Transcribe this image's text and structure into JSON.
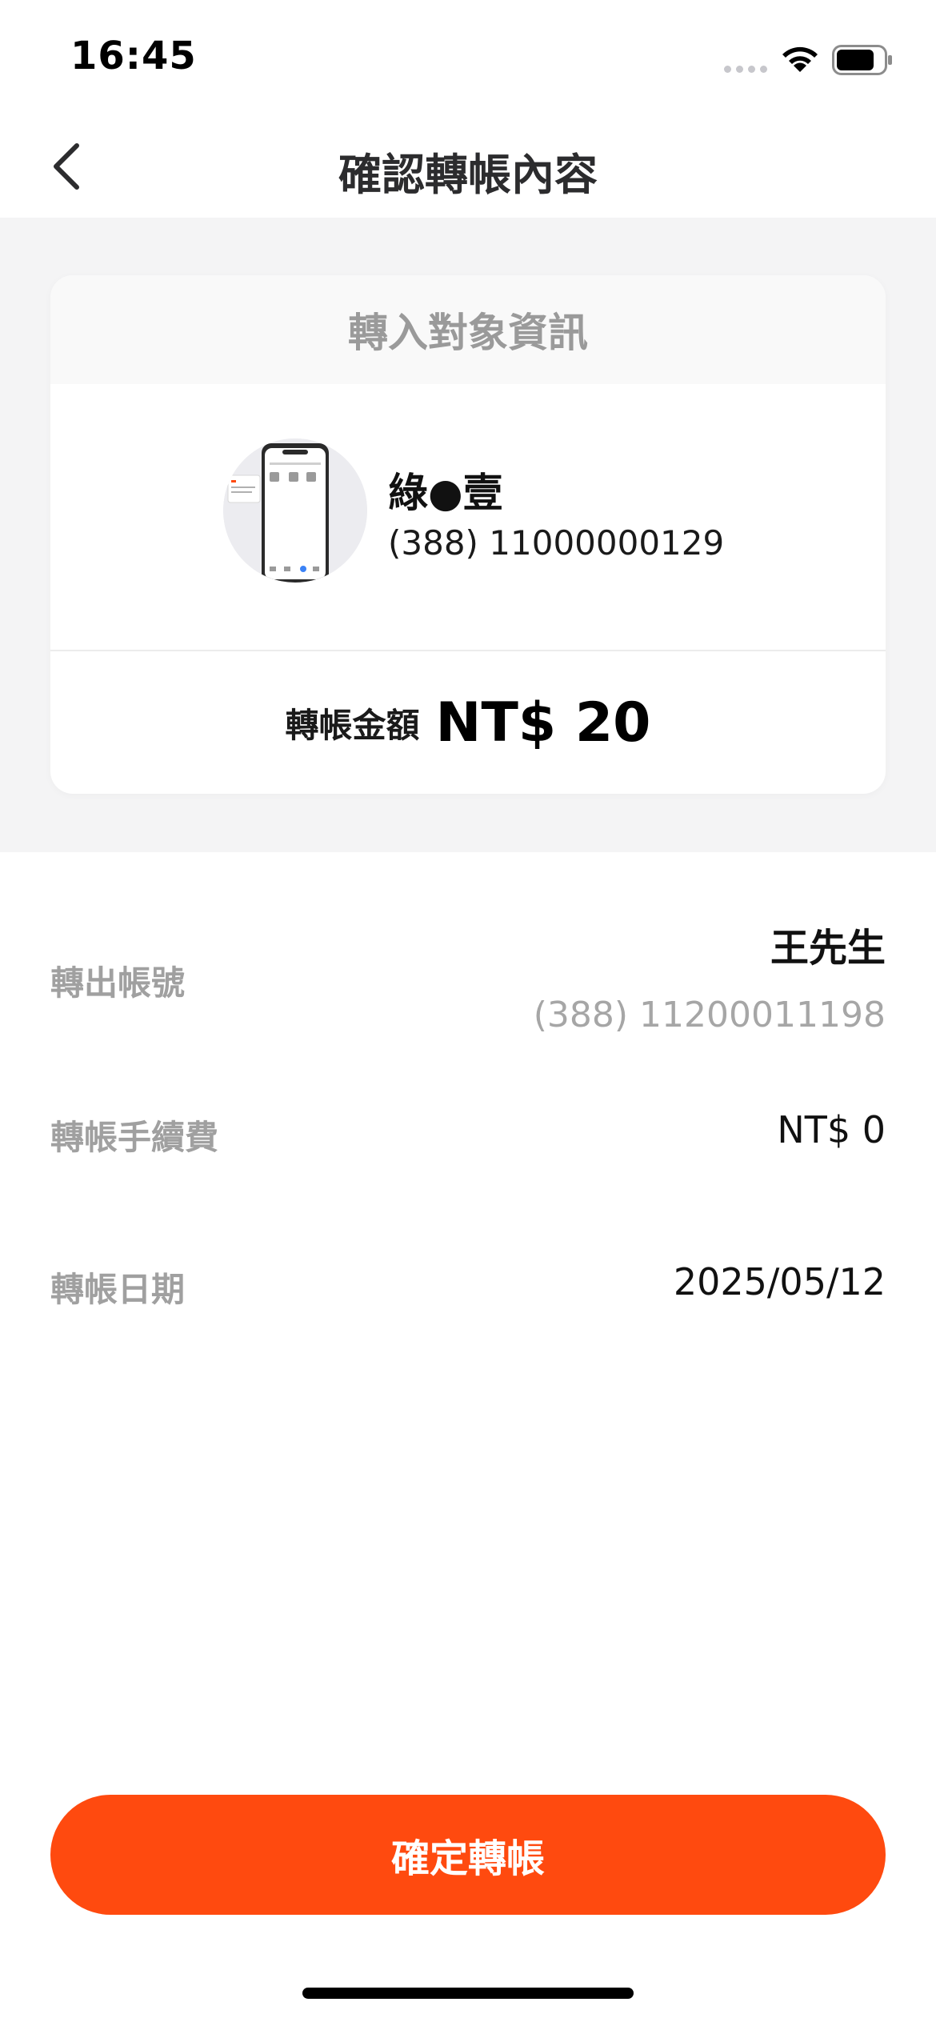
{
  "status_bar": {
    "time": "16:45"
  },
  "nav": {
    "title": "確認轉帳內容"
  },
  "recipient_card": {
    "header": "轉入對象資訊",
    "name": "綠●壹",
    "account": "(388) 11000000129",
    "amount_label": "轉帳金額",
    "amount_value": "NT$ 20"
  },
  "details": {
    "from_label": "轉出帳號",
    "from_name": "王先生",
    "from_account": "(388) 11200011198",
    "fee_label": "轉帳手續費",
    "fee_value": "NT$ 0",
    "date_label": "轉帳日期",
    "date_value": "2025/05/12"
  },
  "actions": {
    "confirm_label": "確定轉帳"
  },
  "colors": {
    "accent": "#ff4a0f",
    "background_gray": "#f4f4f5"
  },
  "icons": [
    "chevron-left-icon",
    "wifi-icon",
    "battery-icon",
    "signal-icon"
  ]
}
